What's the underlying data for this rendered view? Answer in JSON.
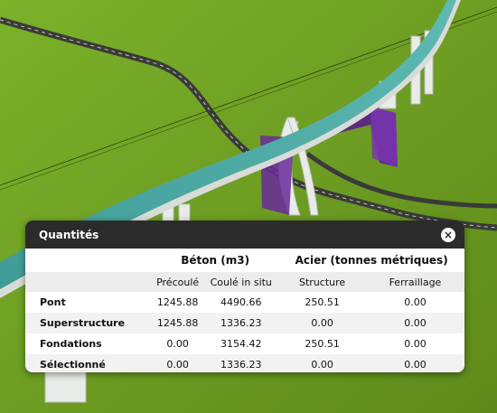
{
  "panel": {
    "title": "Quantités",
    "close_label": "×",
    "groups": {
      "beton": "Béton (m3)",
      "acier": "Acier (tonnes métriques)"
    },
    "columns": [
      "Précoulé",
      "Coulé in situ",
      "Structure",
      "Ferraillage"
    ],
    "rows": [
      {
        "label": "Pont",
        "values": [
          "1245.88",
          "4490.66",
          "250.51",
          "0.00"
        ]
      },
      {
        "label": "Superstructure",
        "values": [
          "1245.88",
          "1336.23",
          "0.00",
          "0.00"
        ]
      },
      {
        "label": "Fondations",
        "values": [
          "0.00",
          "3154.42",
          "250.51",
          "0.00"
        ]
      },
      {
        "label": "Sélectionné",
        "values": [
          "0.00",
          "1336.23",
          "0.00",
          "0.00"
        ]
      }
    ]
  },
  "colors": {
    "grass": "#6f9a1e",
    "deck": "#4aa7a3",
    "selection": "#5a1f8a",
    "header": "#2b2b2b"
  }
}
